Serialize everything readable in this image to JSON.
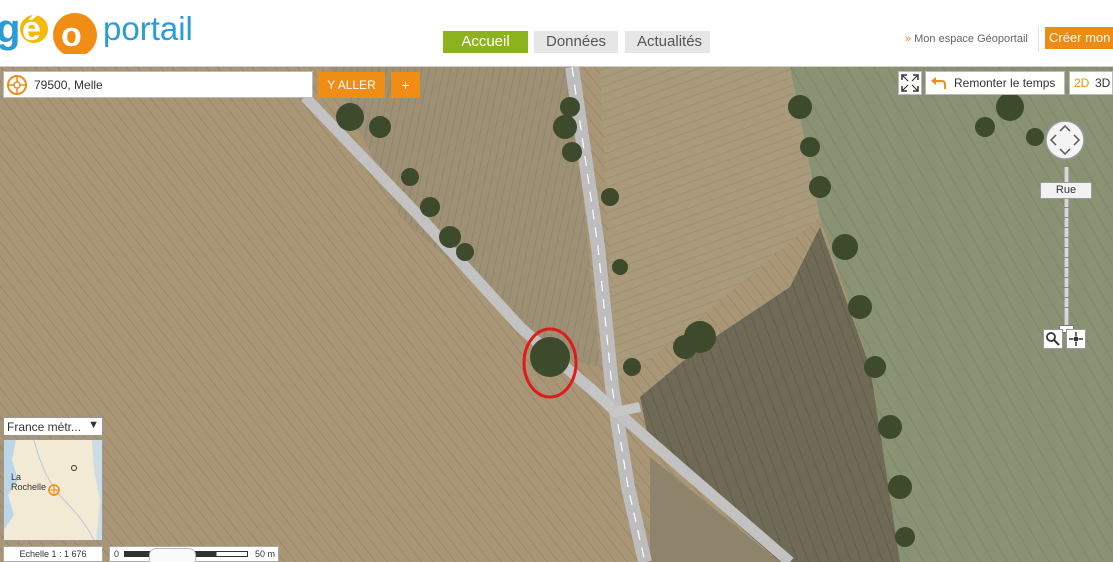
{
  "header": {
    "logo": {
      "text_a": "g",
      "text_b": "é",
      "text_c": "o",
      "text_d": "portail"
    },
    "nav": [
      {
        "label": "Accueil",
        "active": true
      },
      {
        "label": "Données",
        "active": false
      },
      {
        "label": "Actualités",
        "active": false
      }
    ],
    "mon_espace": "Mon espace Géoportail",
    "creer": "Créer mon"
  },
  "search": {
    "value": "79500, Melle",
    "go_label": "Y ALLER",
    "plus_label": "+"
  },
  "tools": {
    "remonter_label": "Remonter le temps",
    "view_2d": "2D",
    "view_3d": "3D",
    "zoom_level_label": "Rue"
  },
  "overview": {
    "territory": "France métr...",
    "place_label_1": "La",
    "place_label_2": "Rochelle"
  },
  "scale": {
    "ratio_label": "Echelle 1 :",
    "ratio_value": "1 676",
    "bar_start": "0",
    "bar_end": "50 m"
  },
  "colors": {
    "accent_orange": "#ef8d14",
    "nav_active": "#8cb21d",
    "logo_blue": "#2b9cd6",
    "marker_red": "#e01b1b"
  },
  "icons": [
    "locate-icon",
    "fullscreen-icon",
    "undo-arrow-icon",
    "pan-compass-icon",
    "magnifier-icon",
    "crosshair-icon"
  ]
}
